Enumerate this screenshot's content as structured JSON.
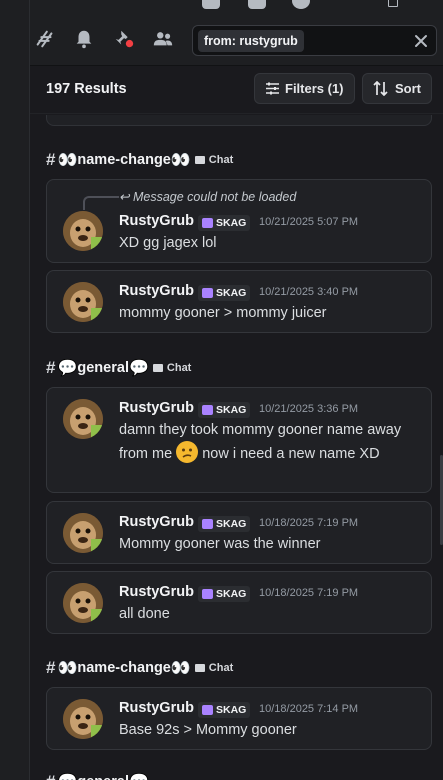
{
  "header": {
    "search_query": "from: rustygrub"
  },
  "results": {
    "count_label": "197 Results",
    "filters_label": "Filters (1)",
    "sort_label": "Sort"
  },
  "groups": [
    {
      "hash": "#",
      "emoji_left": "👀",
      "name": "name-change",
      "emoji_right": "👀",
      "category": "Chat",
      "messages": [
        {
          "reply_text": "Message could not be loaded",
          "author": "RustyGrub",
          "tag": "SKAG",
          "timestamp": "10/21/2025 5:07 PM",
          "text": "XD gg jagex lol"
        },
        {
          "author": "RustyGrub",
          "tag": "SKAG",
          "timestamp": "10/21/2025 3:40 PM",
          "text": "mommy gooner > mommy juicer"
        }
      ]
    },
    {
      "hash": "#",
      "emoji_left": "💬",
      "name": "general",
      "emoji_right": "💬",
      "category": "Chat",
      "messages": [
        {
          "author": "RustyGrub",
          "tag": "SKAG",
          "timestamp": "10/21/2025 3:36 PM",
          "text_a": "damn they took mommy gooner name away from me",
          "text_b": "now i need a new name XD"
        },
        {
          "author": "RustyGrub",
          "tag": "SKAG",
          "timestamp": "10/18/2025 7:19 PM",
          "text": "Mommy gooner was the winner"
        },
        {
          "author": "RustyGrub",
          "tag": "SKAG",
          "timestamp": "10/18/2025 7:19 PM",
          "text": "all done"
        }
      ]
    },
    {
      "hash": "#",
      "emoji_left": "👀",
      "name": "name-change",
      "emoji_right": "👀",
      "category": "Chat",
      "messages": [
        {
          "author": "RustyGrub",
          "tag": "SKAG",
          "timestamp": "10/18/2025 7:14 PM",
          "text": "Base 92s > Mommy gooner"
        }
      ]
    },
    {
      "hash": "#",
      "emoji_left": "💬",
      "name": "general",
      "emoji_right": "💬"
    }
  ]
}
